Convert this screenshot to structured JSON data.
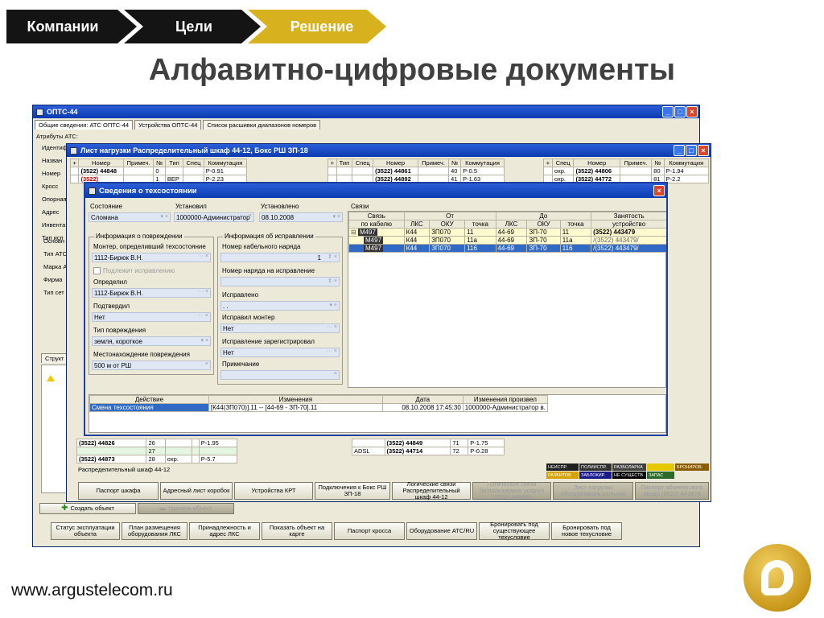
{
  "nav": {
    "step1": "Компании",
    "step2": "Цели",
    "step3": "Решение"
  },
  "slide_title": "Алфавитно-цифровые документы",
  "footer_url": "www.argustelecom.ru",
  "main_window": {
    "title": "ОПТС-44",
    "tabs": [
      "Общие сведения: АТС ОПТС-44",
      "Устройства ОПТС-44",
      "Список расшивки диапазонов номеров"
    ],
    "attributes_label": "Атрибуты АТС:",
    "side_labels": [
      "Идентиф",
      "Назван",
      "Номер",
      "Кросс",
      "Опорная",
      "Адрес",
      "Инвента",
      "Тип исп"
    ],
    "side_labels2": [
      "Основн",
      "Тип АТС",
      "Марка А",
      "Фирма",
      "Тип сет"
    ],
    "struct_tab": "Структ",
    "create_button": "Создать объект",
    "delete_button": "Удалить объект",
    "bottom_buttons": [
      "Статус эксплуатации объекта",
      "План размещения оборудования ЛКС",
      "Принадлежность и адрес ЛКС",
      "Показать объект на карте",
      "Паспорт кросса",
      "Оборудование АТС/RU",
      "Бронировать под существующее техусловие",
      "Бронировать под новое техусловие"
    ]
  },
  "load_window": {
    "title": "Лист нагрузки Распределительный шкаф 44-12, Бокс РШ ЗП-18",
    "columns_left": [
      "+",
      "Номер",
      "Примеч.",
      "№",
      "Тип",
      "Спец",
      "Коммутация"
    ],
    "rows_left": [
      [
        "(3522) 44848",
        "",
        "0",
        "",
        "",
        "Р-0.91"
      ],
      [
        "(3522)",
        "",
        "1",
        "BEP",
        "",
        "Р-2.23"
      ]
    ],
    "columns_mid": [
      "+",
      "Тип",
      "Спец",
      "Номер",
      "Примеч.",
      "№",
      "Коммутация"
    ],
    "rows_mid": [
      [
        "(3522) 44861",
        "",
        "40",
        "Р-0.5"
      ],
      [
        "(3522) 44892",
        "",
        "41",
        "Р-1.63"
      ]
    ],
    "columns_right": [
      "+",
      "Спец",
      "Номер",
      "Примеч.",
      "№",
      "Коммутация"
    ],
    "rows_right": [
      [
        "охр.",
        "(3522) 44806",
        "",
        "80",
        "Р-1.94"
      ],
      [
        "охр.",
        "(3522) 44772",
        "",
        "81",
        "Р-2.2"
      ]
    ],
    "lower_rows_left": [
      [
        "(3522) 44826",
        "26",
        "",
        "",
        "Р-1.95"
      ],
      [
        "",
        "27",
        "",
        "",
        ""
      ],
      [
        "(3522) 44873",
        "28",
        "охр.",
        "",
        "Р-5.7"
      ]
    ],
    "lower_rows_mid": [
      [
        "",
        "(3522) 44849",
        "71",
        "Р-1.75"
      ],
      [
        "ADSL",
        "(3522) 44714",
        "72",
        "Р-0.28"
      ]
    ],
    "status_text": "Распределительный шкаф 44-12",
    "legend": [
      {
        "label": "НЕИСПР.",
        "color": "#202020"
      },
      {
        "label": "ПОЛИИСПР.",
        "color": "#303030"
      },
      {
        "label": "РАЗБОЛАРКА",
        "color": "#404040"
      },
      {
        "label": "",
        "color": "#e6c800"
      },
      {
        "label": "БРОНИРОВ.",
        "color": "#8a5d00"
      },
      {
        "label": "РАЗБИТОВ",
        "color": "#d4a300"
      },
      {
        "label": "ЗАБЛОКИР.",
        "color": "#1a1a8a"
      },
      {
        "label": "НЕ СУЩЕСТВ.",
        "color": "#000000"
      },
      {
        "label": "ЗАПАС",
        "color": "#2a6a2a"
      }
    ],
    "buttons": [
      "Паспорт шкафа",
      "Адресный лист коробок",
      "Устройства КРТ",
      "Подключения к Бокс РШ ЗП-18",
      "Логические связи Распределительный шкаф 44-12",
      "Логические связи (используемые услуги) (3522) 443488",
      "Лист нагрузки оборудования дальний",
      "Паспорт абонентского ввода (3522) 443479"
    ]
  },
  "dialog": {
    "title": "Сведения о техсостоянии",
    "state_label": "Состояние",
    "state_value": "Сломана",
    "installed_by_label": "Установил",
    "installed_by_value": "1000000-Администратор",
    "installed_label": "Установлено",
    "installed_value": "08.10.2008",
    "damage_group": "Информация о повреждении",
    "repair_group": "Информация об исправлении",
    "fitter_label": "Монтер, определивший техсостояние",
    "fitter_value": "1112-Бирюк В.Н.",
    "cable_order_label": "Номер кабельного наряда",
    "cable_order_value": "1",
    "needs_fix_label": "Подлежит исправлению",
    "repair_order_label": "Номер наряда на исправление",
    "determined_label": "Определил",
    "determined_value": "1112-Бирюк В.Н.",
    "fixed_label": "Исправлено",
    "fixed_value": ". .",
    "confirmed_label": "Подтвердил",
    "confirmed_value": "Нет",
    "fixed_by_label": "Исправил монтер",
    "fixed_by_value": "Нет",
    "damage_type_label": "Тип повреждения",
    "damage_type_value": "земля, короткое",
    "fix_registered_label": "Исправление зарегистрировал",
    "fix_registered_value": "Нет",
    "location_label": "Местонахождение повреждения",
    "location_value": "500 м от РШ",
    "note_label": "Примечание",
    "links_label": "Связи",
    "links_head_top": [
      "Связь",
      "От",
      "До",
      "Занятость"
    ],
    "links_head": [
      "по кабелю",
      "ЛКС",
      "ОКУ",
      "точка",
      "ЛКС",
      "ОКУ",
      "точка",
      "устройство"
    ],
    "links_rows": [
      [
        "М497",
        "К44",
        "ЗП070",
        "11",
        "44-69",
        "ЗП-70",
        "11",
        "(3522) 443479"
      ],
      [
        "М497",
        "К44",
        "ЗП070",
        "11а",
        "44-69",
        "ЗП-70",
        "11а",
        "/(3522) 443479/"
      ],
      [
        "М497",
        "К44",
        "ЗП070",
        "116",
        "44-69",
        "ЗП-70",
        "116",
        "/(3522) 443479/"
      ]
    ],
    "history_head": [
      "Действие",
      "Изменения",
      "Дата",
      "Изменения произвел"
    ],
    "history_rows": [
      [
        "Смена техсостояния",
        "[К44(ЗП070)].11 -- [44-69 - ЗП-70].11",
        "08.10.2008 17:45:30",
        "1000000-Администратор в."
      ]
    ]
  }
}
